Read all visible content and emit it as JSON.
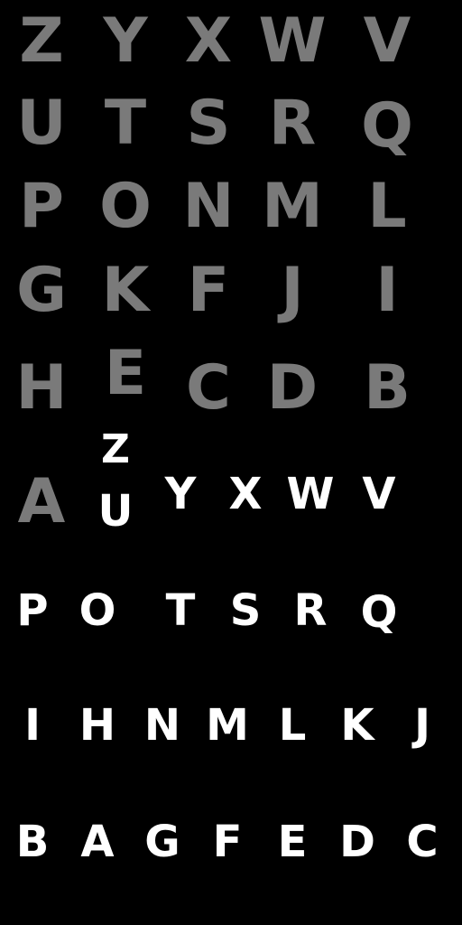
{
  "colors": {
    "background": "#000000",
    "gray_letters": "#7a7a7a",
    "white_letters": "#ffffff"
  },
  "gray_set": {
    "rows": [
      [
        "Z",
        "Y",
        "X",
        "W",
        "V"
      ],
      [
        "U",
        "T",
        "S",
        "R",
        "Q"
      ],
      [
        "P",
        "O",
        "N",
        "M",
        "L"
      ],
      [
        "G",
        "K",
        "F",
        "J",
        "I"
      ],
      [
        "H",
        "E",
        "C",
        "D",
        "B"
      ],
      [
        "A"
      ]
    ]
  },
  "white_set": {
    "rows": [
      [
        "Z"
      ],
      [
        "U",
        "Y",
        "X",
        "W",
        "V"
      ],
      [
        "P",
        "O",
        "T",
        "S",
        "R",
        "Q"
      ],
      [
        "I",
        "H",
        "N",
        "M",
        "L",
        "K",
        "J"
      ],
      [
        "B",
        "A",
        "G",
        "F",
        "E",
        "D",
        "C"
      ]
    ]
  }
}
